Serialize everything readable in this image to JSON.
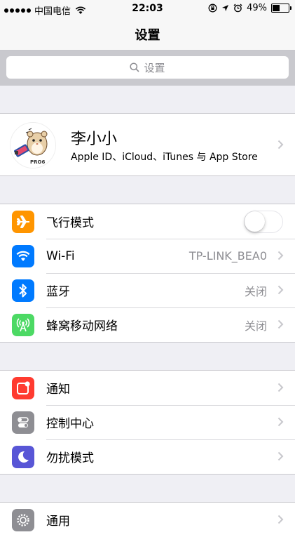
{
  "status_bar": {
    "carrier": "中国电信",
    "time": "22:03",
    "battery": "49%",
    "battery_level": 0.49
  },
  "nav": {
    "title": "设置"
  },
  "search": {
    "placeholder": "设置"
  },
  "profile": {
    "name": "李小小",
    "subtitle": "Apple ID、iCloud、iTunes 与 App Store",
    "avatar_caption": "PRO6"
  },
  "connectivity": [
    {
      "label": "飞行模式",
      "icon": "airplane-icon",
      "color": "#ff9500",
      "toggle": false
    },
    {
      "label": "Wi-Fi",
      "icon": "wifi-icon",
      "color": "#007aff",
      "value": "TP-LINK_BEA0"
    },
    {
      "label": "蓝牙",
      "icon": "bluetooth-icon",
      "color": "#007aff",
      "value": "关闭"
    },
    {
      "label": "蜂窝移动网络",
      "icon": "cellular-icon",
      "color": "#4cd964",
      "value": "关闭"
    }
  ],
  "system": [
    {
      "label": "通知",
      "icon": "notifications-icon",
      "color": "#ff3b30"
    },
    {
      "label": "控制中心",
      "icon": "control-center-icon",
      "color": "#8e8e93"
    },
    {
      "label": "勿扰模式",
      "icon": "do-not-disturb-icon",
      "color": "#5856d6"
    }
  ],
  "general": [
    {
      "label": "通用",
      "icon": "gear-icon",
      "color": "#8e8e93"
    }
  ]
}
